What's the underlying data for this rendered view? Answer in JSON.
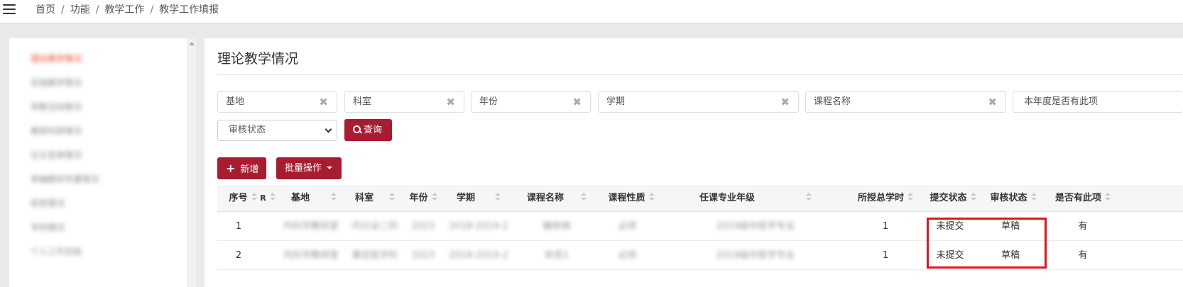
{
  "breadcrumb": [
    "首页",
    "功能",
    "教学工作",
    "教学工作填报"
  ],
  "sidebar": {
    "items": [
      {
        "label": "理论教学情况",
        "active": true
      },
      {
        "label": "实践教学情况",
        "active": false
      },
      {
        "label": "带教活动情况",
        "active": false
      },
      {
        "label": "教研科研情况",
        "active": false
      },
      {
        "label": "论文发表情况",
        "active": false
      },
      {
        "label": "参编教材专著情况",
        "active": false
      },
      {
        "label": "获奖情况",
        "active": false
      },
      {
        "label": "专利情况",
        "active": false
      },
      {
        "label": "个人工作总结",
        "active": false
      }
    ]
  },
  "main": {
    "title": "理论教学情况",
    "filters": {
      "base": "基地",
      "dept": "科室",
      "year": "年份",
      "term": "学期",
      "course": "课程名称",
      "has_item": "本年度是否有此项"
    },
    "clear_glyph": "✖",
    "review_select": "审核状态",
    "query_label": "查询",
    "add_label": "新增",
    "batch_label": "批量操作"
  },
  "table": {
    "headers": {
      "index": "序号",
      "r": "R",
      "base": "基地",
      "dept": "科室",
      "year": "年份",
      "term": "学期",
      "course": "课程名称",
      "nature": "课程性质",
      "major": "任课专业年级",
      "hours": "所授总学时",
      "submit": "提交状态",
      "review": "审核状态",
      "has": "是否有此项"
    },
    "rows": [
      {
        "index": "1",
        "base": "内科学教研室",
        "dept": "内分泌二科",
        "year": "2023",
        "term": "2018-2019-2",
        "course": "糖尿病",
        "nature": "必修",
        "major": "2019级中医学专业",
        "hours": "1",
        "submit": "未提交",
        "review": "草稿",
        "has": "有"
      },
      {
        "index": "2",
        "base": "内科学教研室",
        "dept": "重症医学科",
        "year": "2023",
        "term": "2018-2019-2",
        "course": "休克1",
        "nature": "必修",
        "major": "2019级中医学专业",
        "hours": "1",
        "submit": "未提交",
        "review": "草稿",
        "has": "有"
      }
    ]
  },
  "colors": {
    "accent": "#a81c30",
    "active_link": "#e2452f",
    "highlight": "#e0161a"
  }
}
